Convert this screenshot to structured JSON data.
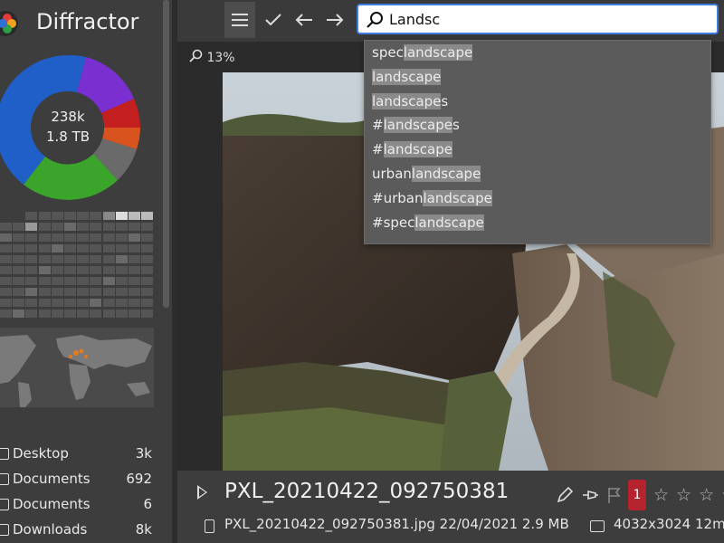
{
  "app": {
    "title": "Diffractor"
  },
  "sidebar": {
    "donut_line1": "238k",
    "donut_line2": "1.8 TB",
    "folders": [
      {
        "name": "Desktop",
        "count": "3k"
      },
      {
        "name": "Documents",
        "count": "692"
      },
      {
        "name": "Documents",
        "count": "6"
      },
      {
        "name": "Downloads",
        "count": "8k"
      }
    ]
  },
  "toolbar": {
    "menu_icon": "hamburger-icon",
    "check_icon": "check-icon",
    "back_icon": "arrow-left-icon",
    "forward_icon": "arrow-right-icon"
  },
  "search": {
    "value": "Landsc",
    "icon": "search-icon"
  },
  "viewer": {
    "zoom": "13%"
  },
  "suggestions": [
    {
      "pre": "spec",
      "match": "landscape",
      "post": ""
    },
    {
      "pre": "",
      "match": "landscape",
      "post": ""
    },
    {
      "pre": "",
      "match": "landscape",
      "post": "s"
    },
    {
      "pre": "#",
      "match": "landscape",
      "post": "s"
    },
    {
      "pre": "#",
      "match": "landscape",
      "post": ""
    },
    {
      "pre": "urban",
      "match": "landscape",
      "post": ""
    },
    {
      "pre": "#urban",
      "match": "landscape",
      "post": ""
    },
    {
      "pre": "#spec",
      "match": "landscape",
      "post": ""
    }
  ],
  "info": {
    "title": "PXL_20210422_092750381",
    "flag_count": "1",
    "meta": "PXL_20210422_092750381.jpg 22/04/2021 2.9 MB",
    "dimensions": "4032x3024 12m"
  },
  "colors": {
    "accent": "#3c7be0",
    "flag": "#b5232f",
    "donut_blue": "#1f5fc7",
    "donut_purple": "#7a2fd0",
    "donut_red": "#c41f1f",
    "donut_orange": "#d9531e",
    "donut_gray": "#6a6a6a",
    "donut_green": "#3aa52a"
  }
}
